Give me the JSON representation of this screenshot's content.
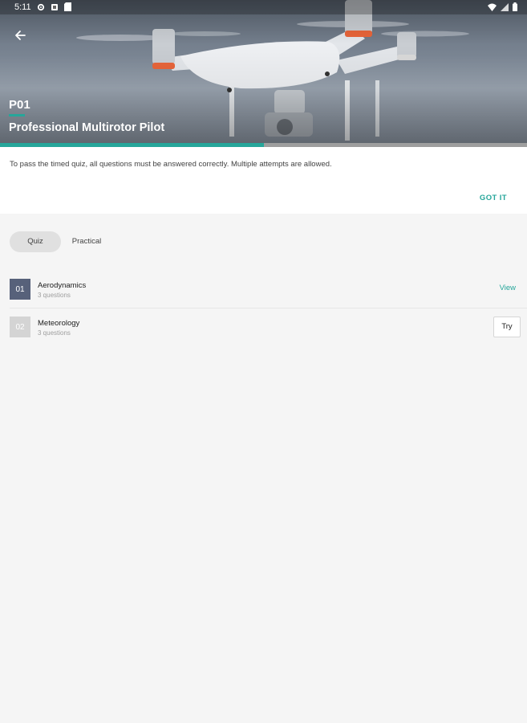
{
  "status_bar": {
    "time": "5:11",
    "left_icons": [
      "settings-icon",
      "notification-icon",
      "sd-card-icon"
    ],
    "right_icons": [
      "wifi-icon",
      "signal-icon",
      "battery-icon"
    ]
  },
  "header": {
    "back_icon": "back-arrow-icon",
    "course_code": "P01",
    "course_title": "Professional Multirotor Pilot",
    "progress_fraction": 0.5,
    "accent_color": "#26a69a"
  },
  "info_card": {
    "message": "To pass the timed quiz, all questions must be answered correctly. Multiple attempts are allowed.",
    "action_label": "GOT IT"
  },
  "tabs": [
    {
      "label": "Quiz",
      "selected": true
    },
    {
      "label": "Practical",
      "selected": false
    }
  ],
  "modules": [
    {
      "number": "01",
      "title": "Aerodynamics",
      "subtitle": "3 questions",
      "action_label": "View",
      "completed": true
    },
    {
      "number": "02",
      "title": "Meteorology",
      "subtitle": "3 questions",
      "action_label": "Try",
      "completed": false
    }
  ]
}
